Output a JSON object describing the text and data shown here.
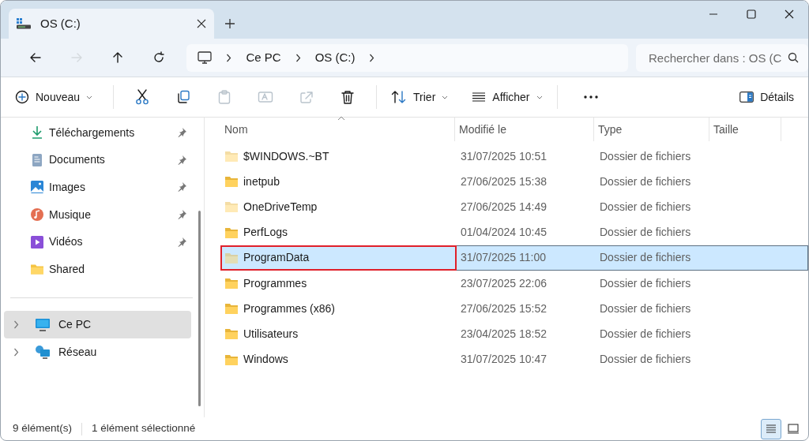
{
  "window": {
    "tab_title": "OS (C:)"
  },
  "navigation": [
    {
      "kind": "back",
      "disabled": false
    },
    {
      "kind": "forward",
      "disabled": true
    },
    {
      "kind": "up",
      "disabled": false
    },
    {
      "kind": "refresh",
      "disabled": false
    }
  ],
  "breadcrumb": [
    "Ce PC",
    "OS (C:)"
  ],
  "search": {
    "placeholder": "Rechercher dans : OS (C"
  },
  "toolbar": [
    {
      "kind": "new",
      "label": "Nouveau",
      "disabled": false
    },
    {
      "kind": "cut",
      "disabled": false
    },
    {
      "kind": "copy",
      "disabled": false
    },
    {
      "kind": "paste",
      "disabled": true
    },
    {
      "kind": "rename",
      "disabled": true
    },
    {
      "kind": "share",
      "disabled": true
    },
    {
      "kind": "delete",
      "disabled": false
    },
    {
      "kind": "sort",
      "label": "Trier",
      "disabled": false
    },
    {
      "kind": "view",
      "label": "Afficher",
      "disabled": false
    },
    {
      "kind": "more",
      "disabled": false
    }
  ],
  "details_button": {
    "label": "Détails"
  },
  "sidebar": {
    "quick_access": [
      {
        "kind": "downloads",
        "label": "Téléchargements",
        "pinned": true
      },
      {
        "kind": "documents",
        "label": "Documents",
        "pinned": true
      },
      {
        "kind": "images",
        "label": "Images",
        "pinned": true
      },
      {
        "kind": "music",
        "label": "Musique",
        "pinned": true
      },
      {
        "kind": "videos",
        "label": "Vidéos",
        "pinned": true
      },
      {
        "kind": "folder",
        "label": "Shared",
        "pinned": false
      }
    ],
    "tree": [
      {
        "kind": "pc",
        "label": "Ce PC",
        "selected": true
      },
      {
        "kind": "network",
        "label": "Réseau",
        "selected": false
      }
    ]
  },
  "table": {
    "columns": [
      {
        "label": "Nom",
        "sorted": true
      },
      {
        "label": "Modifié le",
        "sorted": false
      },
      {
        "label": "Type",
        "sorted": false
      },
      {
        "label": "Taille",
        "sorted": false
      }
    ],
    "rows": [
      {
        "name": "$WINDOWS.~BT",
        "modified": "31/07/2025 10:51",
        "type": "Dossier de fichiers",
        "hidden": true,
        "selected": false,
        "highlighted": false
      },
      {
        "name": "inetpub",
        "modified": "27/06/2025 15:38",
        "type": "Dossier de fichiers",
        "hidden": false,
        "selected": false,
        "highlighted": false
      },
      {
        "name": "OneDriveTemp",
        "modified": "27/06/2025 14:49",
        "type": "Dossier de fichiers",
        "hidden": true,
        "selected": false,
        "highlighted": false
      },
      {
        "name": "PerfLogs",
        "modified": "01/04/2024 10:45",
        "type": "Dossier de fichiers",
        "hidden": false,
        "selected": false,
        "highlighted": false
      },
      {
        "name": "ProgramData",
        "modified": "31/07/2025 11:00",
        "type": "Dossier de fichiers",
        "hidden": true,
        "selected": true,
        "highlighted": true
      },
      {
        "name": "Programmes",
        "modified": "23/07/2025 22:06",
        "type": "Dossier de fichiers",
        "hidden": false,
        "selected": false,
        "highlighted": false
      },
      {
        "name": "Programmes (x86)",
        "modified": "27/06/2025 15:52",
        "type": "Dossier de fichiers",
        "hidden": false,
        "selected": false,
        "highlighted": false
      },
      {
        "name": "Utilisateurs",
        "modified": "23/04/2025 18:52",
        "type": "Dossier de fichiers",
        "hidden": false,
        "selected": false,
        "highlighted": false
      },
      {
        "name": "Windows",
        "modified": "31/07/2025 10:47",
        "type": "Dossier de fichiers",
        "hidden": false,
        "selected": false,
        "highlighted": false
      }
    ]
  },
  "status_bar": {
    "count": "9 élément(s)",
    "selection": "1 élément sélectionné"
  },
  "view_buttons": [
    {
      "kind": "details",
      "selected": true
    },
    {
      "kind": "tiles",
      "selected": false
    }
  ]
}
